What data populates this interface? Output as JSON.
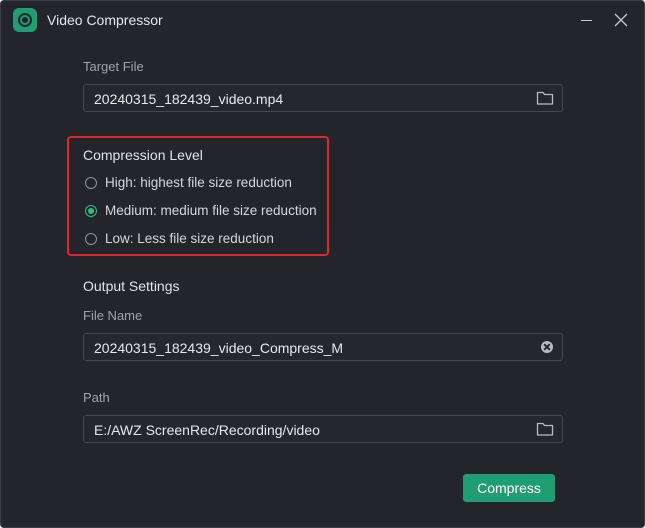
{
  "window": {
    "title": "Video Compressor"
  },
  "target": {
    "label": "Target File",
    "value": "20240315_182439_video.mp4"
  },
  "compression": {
    "heading": "Compression Level",
    "options": [
      {
        "label": "High: highest file size reduction",
        "selected": false
      },
      {
        "label": "Medium: medium file size reduction",
        "selected": true
      },
      {
        "label": "Low: Less file size reduction",
        "selected": false
      }
    ]
  },
  "output": {
    "heading": "Output Settings",
    "file_name_label": "File Name",
    "file_name_value": "20240315_182439_video_Compress_M",
    "path_label": "Path",
    "path_value": "E:/AWZ ScreenRec/Recording/video"
  },
  "actions": {
    "compress_label": "Compress"
  },
  "colors": {
    "accent": "#1f9d73",
    "radio_selected": "#29c08a",
    "highlight": "#e0262b",
    "background": "#23252b"
  },
  "icons": [
    "app-logo-icon",
    "minimize-icon",
    "close-icon",
    "folder-icon",
    "clear-icon"
  ]
}
